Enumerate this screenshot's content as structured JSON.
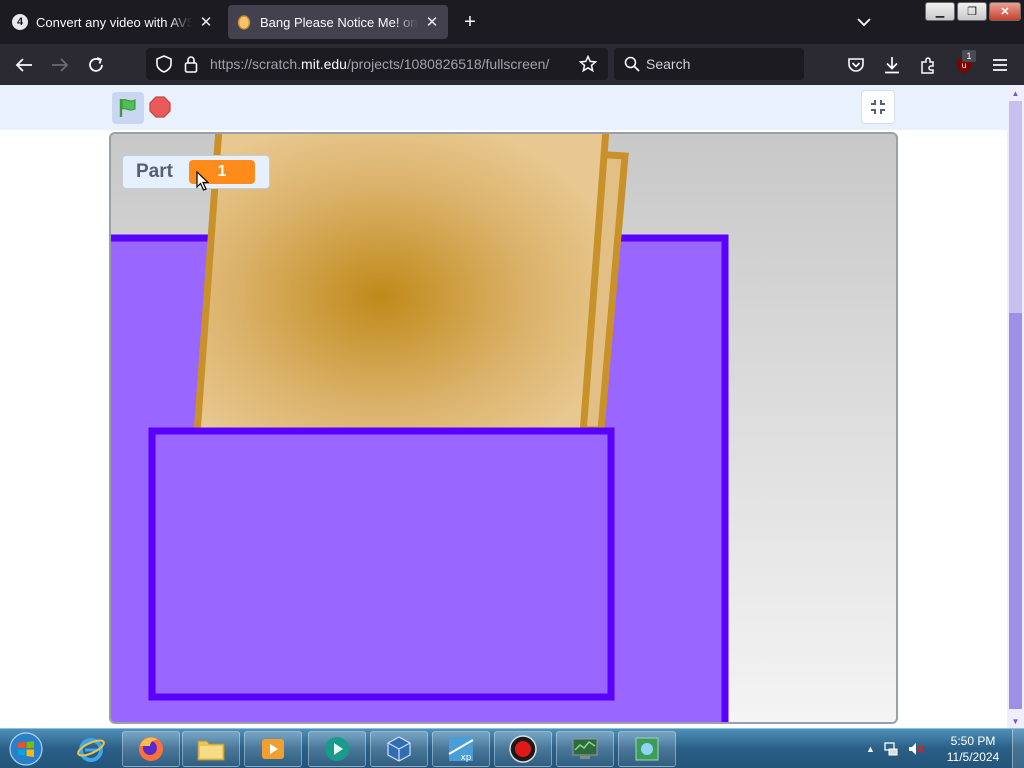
{
  "browser": {
    "tabs": [
      {
        "title": "Convert any video with AVS Free",
        "favicon_text": "4",
        "active": false
      },
      {
        "title": "Bang Please Notice Me! on Scratch",
        "active": true
      }
    ],
    "url": {
      "prefix": "https://scratch.",
      "domain": "mit.edu",
      "path": "/projects/1080826518/fullscreen/"
    },
    "search_placeholder": "Search",
    "extension_badge": "1"
  },
  "scratch": {
    "monitor": {
      "label": "Part",
      "value": "1"
    }
  },
  "taskbar": {
    "clock_time": "5:50 PM",
    "clock_date": "11/5/2024"
  },
  "colors": {
    "stage_purple": "#9966ff",
    "stage_purple_border": "#5a00ff",
    "paper_gold": "#c8912a",
    "monitor_orange": "#ff8c1a"
  }
}
